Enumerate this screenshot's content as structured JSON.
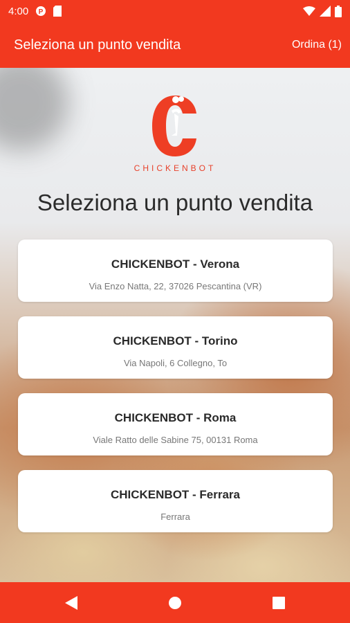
{
  "status_bar": {
    "time": "4:00",
    "icons": [
      "app-notification-icon",
      "sim-card-icon",
      "wifi-icon",
      "signal-icon",
      "battery-icon"
    ]
  },
  "app_bar": {
    "title": "Seleziona un punto vendita",
    "order_label": "Ordina (1)"
  },
  "logo": {
    "brand": "CHICKENBOT"
  },
  "page": {
    "heading": "Seleziona un punto vendita"
  },
  "stores": [
    {
      "name": "CHICKENBOT - Verona",
      "address": "Via Enzo Natta, 22, 37026 Pescantina (VR)"
    },
    {
      "name": "CHICKENBOT - Torino",
      "address": "Via Napoli, 6 Collegno, To"
    },
    {
      "name": "CHICKENBOT - Roma",
      "address": "Viale Ratto delle Sabine 75,  00131 Roma"
    },
    {
      "name": "CHICKENBOT - Ferrara",
      "address": "Ferrara"
    }
  ],
  "nav_bar": {
    "buttons": [
      "back-icon",
      "home-icon",
      "recents-icon"
    ]
  },
  "colors": {
    "accent": "#f2391f",
    "logo_red": "#e8402a",
    "card_bg": "#ffffff"
  }
}
